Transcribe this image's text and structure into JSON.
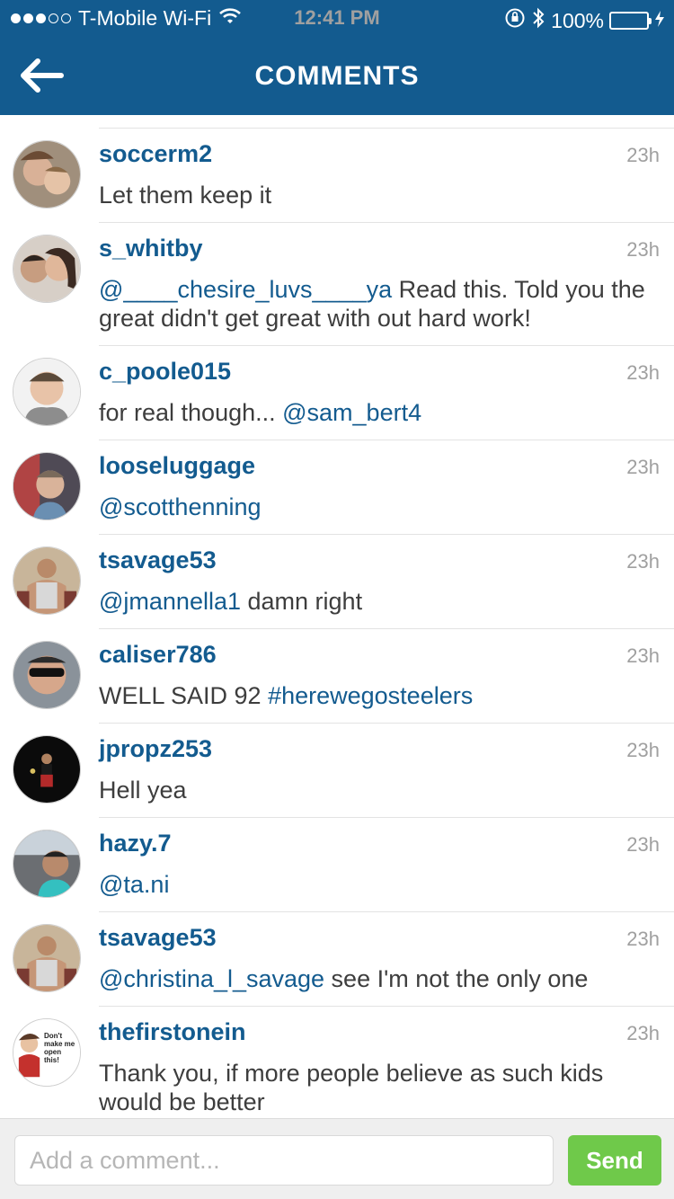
{
  "status_bar": {
    "carrier": "T-Mobile Wi-Fi",
    "time": "12:41 PM",
    "battery": "100%"
  },
  "nav": {
    "title": "COMMENTS",
    "back_icon": "arrow-left-icon"
  },
  "comments": [
    {
      "username": "soccerm2",
      "time": "23h",
      "text": [
        {
          "t": "Let them keep it",
          "m": false
        }
      ]
    },
    {
      "username": "s_whitby",
      "time": "23h",
      "text": [
        {
          "t": "@____chesire_luvs____ya",
          "m": true
        },
        {
          "t": " Read this. Told you the great didn't get great with out hard work!",
          "m": false
        }
      ]
    },
    {
      "username": "c_poole015",
      "time": "23h",
      "text": [
        {
          "t": "for real though... ",
          "m": false
        },
        {
          "t": "@sam_bert4",
          "m": true
        }
      ]
    },
    {
      "username": "looseluggage",
      "time": "23h",
      "text": [
        {
          "t": "@scotthenning",
          "m": true
        }
      ]
    },
    {
      "username": "tsavage53",
      "time": "23h",
      "text": [
        {
          "t": "@jmannella1",
          "m": true
        },
        {
          "t": " damn right",
          "m": false
        }
      ]
    },
    {
      "username": "caliser786",
      "time": "23h",
      "text": [
        {
          "t": "WELL SAID 92 ",
          "m": false
        },
        {
          "t": "#herewegosteelers",
          "m": true
        }
      ]
    },
    {
      "username": "jpropz253",
      "time": "23h",
      "text": [
        {
          "t": "Hell yea",
          "m": false
        }
      ]
    },
    {
      "username": "hazy.7",
      "time": "23h",
      "text": [
        {
          "t": "@ta.ni",
          "m": true
        }
      ]
    },
    {
      "username": "tsavage53",
      "time": "23h",
      "text": [
        {
          "t": "@christina_l_savage",
          "m": true
        },
        {
          "t": " see I'm not the only one",
          "m": false
        }
      ]
    },
    {
      "username": "thefirstonein",
      "time": "23h",
      "text": [
        {
          "t": "Thank you, if more people believe as such kids would be better",
          "m": false
        }
      ]
    }
  ],
  "avatar_badge": {
    "text": "Don't make me open this!"
  },
  "composer": {
    "placeholder": "Add a comment...",
    "send_label": "Send"
  },
  "colors": {
    "brand": "#135b8f",
    "send": "#6fc94a"
  }
}
